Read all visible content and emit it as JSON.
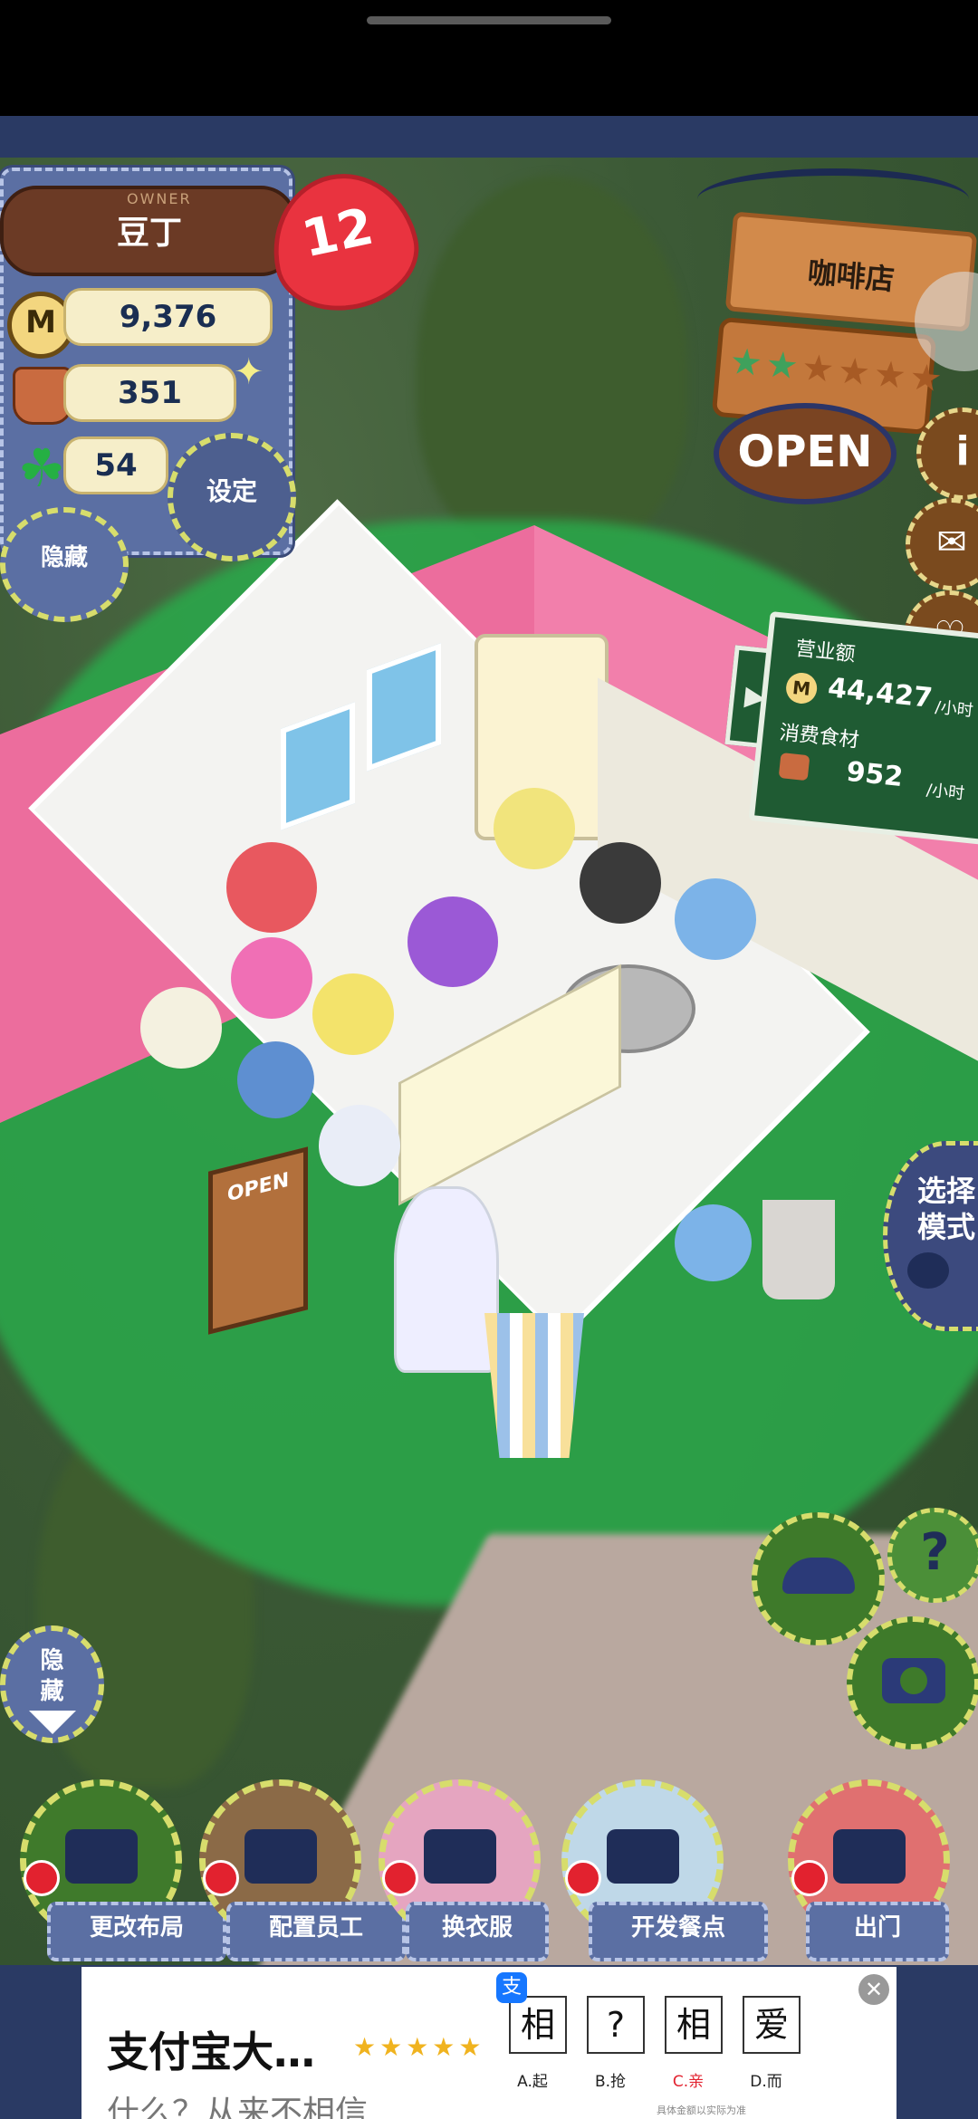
{
  "owner": {
    "label": "OWNER",
    "name": "豆丁",
    "hearts": "12"
  },
  "stats": {
    "coins": "9,376",
    "food": "351",
    "clover": "54",
    "coin_symbol": "M"
  },
  "buttons": {
    "settings": "设定",
    "hide_top": "隐藏",
    "hide_bottom": "隐\n藏",
    "select_mode": "选择\n模式",
    "help": "?",
    "info": "i"
  },
  "cafe": {
    "title": "咖啡店",
    "open_label": "OPEN",
    "stars_filled": 2,
    "stars_total": 6
  },
  "income": {
    "revenue_label": "营业额",
    "revenue_value": "44,427",
    "revenue_unit": "/小时",
    "food_label": "消费食材",
    "food_value": "952",
    "food_unit": "/小时",
    "tab_icon": "▶"
  },
  "shop_sign": {
    "text": "OPEN"
  },
  "actions": [
    {
      "label": "更改布局",
      "icon": "table-icon",
      "color": "#3f7a2b"
    },
    {
      "label": "配置员工",
      "icon": "bear-icon",
      "color": "#8b6a47"
    },
    {
      "label": "换衣服",
      "icon": "shirt-icon",
      "color": "#e5a5c0"
    },
    {
      "label": "开发餐点",
      "icon": "knife-icon",
      "color": "#bfd8e8"
    },
    {
      "label": "出门",
      "icon": "door-icon",
      "color": "#e07070"
    }
  ],
  "ad": {
    "title": "支付宝大…",
    "subtitle": "什么？从来不相信",
    "stars": "★★★★★",
    "logo": "支",
    "close": "✕",
    "boxes": [
      "相",
      "?",
      "相",
      "爱"
    ],
    "options": [
      "A.起",
      "B.抢",
      "C.亲",
      "D.而"
    ],
    "footer": "具体金额以实际为准"
  }
}
